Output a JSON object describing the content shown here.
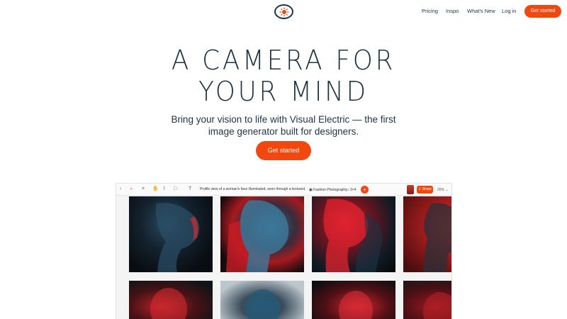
{
  "nav": {
    "logo": "sun-logo-icon",
    "links": [
      "Pricing",
      "Inspo",
      "What's New",
      "Log in"
    ],
    "cta": "Get started"
  },
  "hero": {
    "title_line1": "A CAMERA FOR",
    "title_line2": "YOUR MIND",
    "subtitle_line1": "Bring your vision to life with Visual Electric — the first",
    "subtitle_line2": "image generator built for designers.",
    "cta": "Get started"
  },
  "app": {
    "prompt": "Profile view of a woman's face illuminated, seen through a textured, transl...",
    "style_chip": "Fashion Photography",
    "ratio_chip": "3×4",
    "share": "Share",
    "zoom": "26%",
    "images": [
      "portrait-1",
      "portrait-2",
      "portrait-3",
      "portrait-4",
      "portrait-5",
      "portrait-6",
      "portrait-7",
      "portrait-8"
    ]
  },
  "colors": {
    "accent": "#f2470f",
    "text": "#1d3443"
  }
}
